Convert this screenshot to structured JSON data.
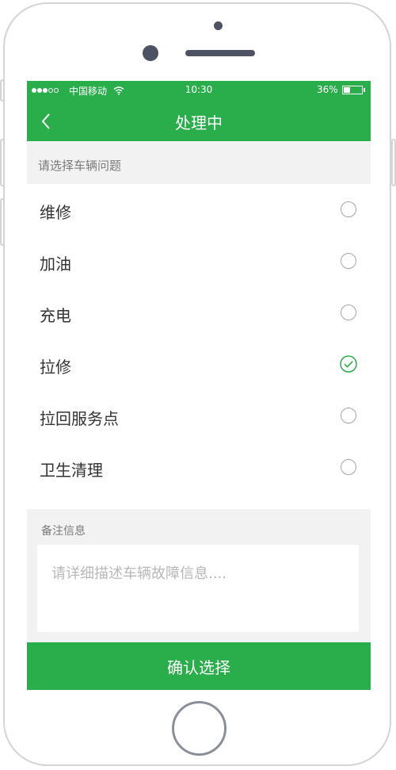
{
  "status_bar": {
    "carrier": "中国移动",
    "time": "10:30",
    "battery_percent": "36%",
    "battery_level": 0.36,
    "signal_bars_filled": 3,
    "signal_bars_total": 5
  },
  "header": {
    "back_icon": "chevron-left-icon",
    "title": "处理中"
  },
  "vehicle_issue": {
    "prompt": "请选择车辆问题",
    "selected_index": 3,
    "options": [
      {
        "label": "维修",
        "checked": false
      },
      {
        "label": "加油",
        "checked": false
      },
      {
        "label": "充电",
        "checked": false
      },
      {
        "label": "拉修",
        "checked": true
      },
      {
        "label": "拉回服务点",
        "checked": false
      },
      {
        "label": "卫生清理",
        "checked": false
      }
    ]
  },
  "remark": {
    "label": "备注信息",
    "placeholder": "请详细描述车辆故障信息....",
    "value": ""
  },
  "confirm_button": {
    "label": "确认选择"
  },
  "colors": {
    "brand_green": "#2aad4b",
    "background": "#f2f2f2",
    "radio_unchecked": "#a5a5a5"
  }
}
